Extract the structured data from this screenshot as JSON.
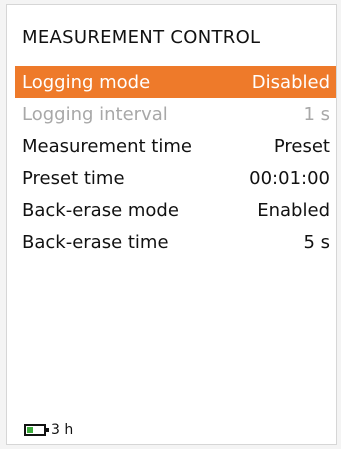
{
  "screen": {
    "title": "MEASUREMENT CONTROL",
    "accent_color": "#ee7a2a"
  },
  "menu": {
    "items": [
      {
        "label": "Logging mode",
        "value": "Disabled",
        "state": "selected"
      },
      {
        "label": "Logging interval",
        "value": "1 s",
        "state": "disabled"
      },
      {
        "label": "Measurement time",
        "value": "Preset",
        "state": "normal"
      },
      {
        "label": "Preset time",
        "value": "00:01:00",
        "state": "normal"
      },
      {
        "label": "Back-erase mode",
        "value": "Enabled",
        "state": "normal"
      },
      {
        "label": "Back-erase time",
        "value": "5 s",
        "state": "normal"
      }
    ]
  },
  "status": {
    "battery_icon": "battery-icon",
    "battery_level": 0.35,
    "battery_color": "#3caa3c",
    "battery_time": "3 h"
  }
}
